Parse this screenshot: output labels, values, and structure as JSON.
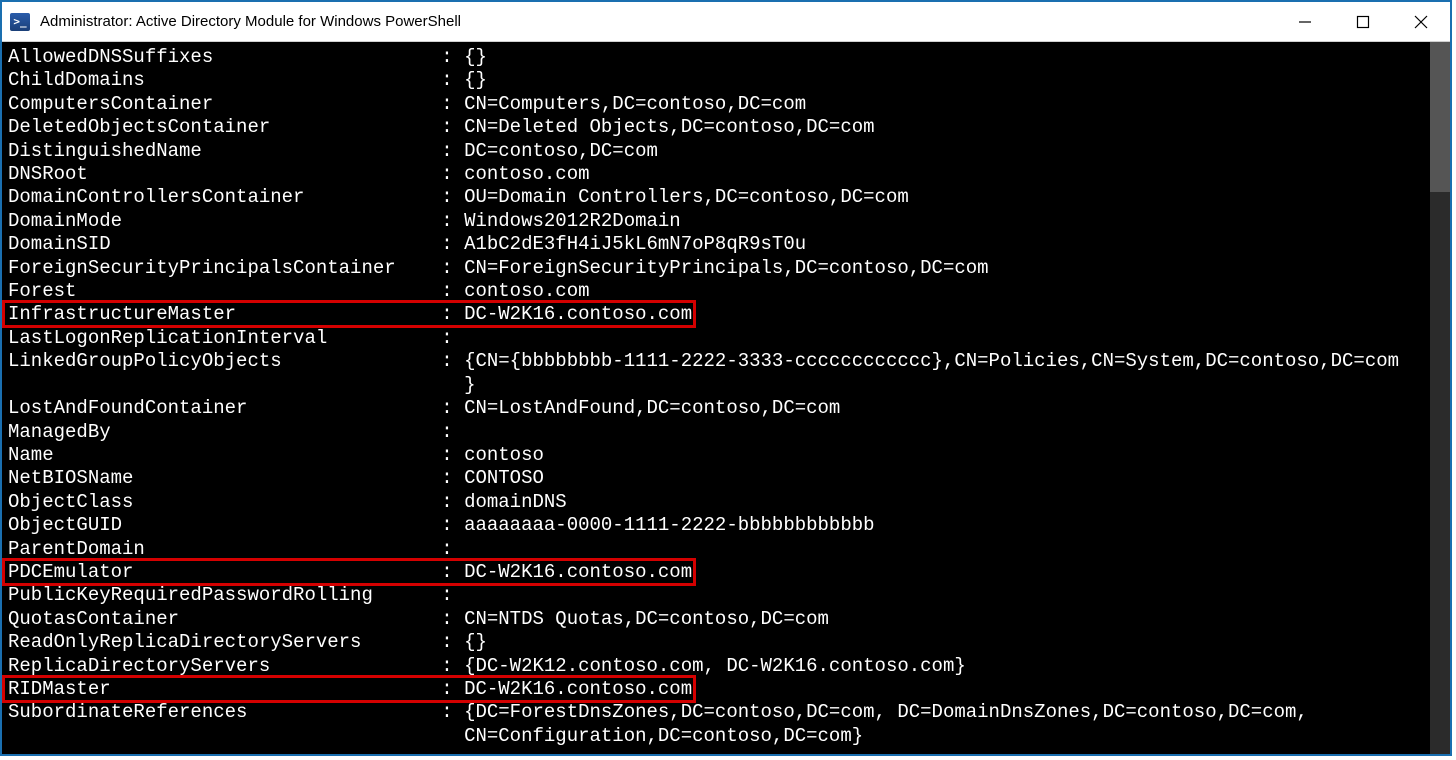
{
  "titlebar": {
    "icon_label": ">_",
    "title": "Administrator: Active Directory Module for Windows PowerShell"
  },
  "kv_width": 38,
  "lines": [
    {
      "key": "AllowedDNSSuffixes",
      "value": "{}",
      "highlight": false
    },
    {
      "key": "ChildDomains",
      "value": "{}",
      "highlight": false
    },
    {
      "key": "ComputersContainer",
      "value": "CN=Computers,DC=contoso,DC=com",
      "highlight": false
    },
    {
      "key": "DeletedObjectsContainer",
      "value": "CN=Deleted Objects,DC=contoso,DC=com",
      "highlight": false
    },
    {
      "key": "DistinguishedName",
      "value": "DC=contoso,DC=com",
      "highlight": false
    },
    {
      "key": "DNSRoot",
      "value": "contoso.com",
      "highlight": false
    },
    {
      "key": "DomainControllersContainer",
      "value": "OU=Domain Controllers,DC=contoso,DC=com",
      "highlight": false
    },
    {
      "key": "DomainMode",
      "value": "Windows2012R2Domain",
      "highlight": false
    },
    {
      "key": "DomainSID",
      "value": "A1bC2dE3fH4iJ5kL6mN7oP8qR9sT0u",
      "highlight": false
    },
    {
      "key": "ForeignSecurityPrincipalsContainer",
      "value": "CN=ForeignSecurityPrincipals,DC=contoso,DC=com",
      "highlight": false
    },
    {
      "key": "Forest",
      "value": "contoso.com",
      "highlight": false
    },
    {
      "key": "InfrastructureMaster",
      "value": "DC-W2K16.contoso.com",
      "highlight": true
    },
    {
      "key": "LastLogonReplicationInterval",
      "value": "",
      "highlight": false
    },
    {
      "key": "LinkedGroupPolicyObjects",
      "value": "{CN={bbbbbbbb-1111-2222-3333-cccccccccccc},CN=Policies,CN=System,DC=contoso,DC=com",
      "highlight": false
    },
    {
      "key": "",
      "value": "}",
      "highlight": false,
      "continuation": true
    },
    {
      "key": "LostAndFoundContainer",
      "value": "CN=LostAndFound,DC=contoso,DC=com",
      "highlight": false
    },
    {
      "key": "ManagedBy",
      "value": "",
      "highlight": false
    },
    {
      "key": "Name",
      "value": "contoso",
      "highlight": false
    },
    {
      "key": "NetBIOSName",
      "value": "CONTOSO",
      "highlight": false
    },
    {
      "key": "ObjectClass",
      "value": "domainDNS",
      "highlight": false
    },
    {
      "key": "ObjectGUID",
      "value": "aaaaaaaa-0000-1111-2222-bbbbbbbbbbbb",
      "highlight": false
    },
    {
      "key": "ParentDomain",
      "value": "",
      "highlight": false
    },
    {
      "key": "PDCEmulator",
      "value": "DC-W2K16.contoso.com",
      "highlight": true
    },
    {
      "key": "PublicKeyRequiredPasswordRolling",
      "value": "",
      "highlight": false
    },
    {
      "key": "QuotasContainer",
      "value": "CN=NTDS Quotas,DC=contoso,DC=com",
      "highlight": false
    },
    {
      "key": "ReadOnlyReplicaDirectoryServers",
      "value": "{}",
      "highlight": false
    },
    {
      "key": "ReplicaDirectoryServers",
      "value": "{DC-W2K12.contoso.com, DC-W2K16.contoso.com}",
      "highlight": false
    },
    {
      "key": "RIDMaster",
      "value": "DC-W2K16.contoso.com",
      "highlight": true
    },
    {
      "key": "SubordinateReferences",
      "value": "{DC=ForestDnsZones,DC=contoso,DC=com, DC=DomainDnsZones,DC=contoso,DC=com,",
      "highlight": false
    },
    {
      "key": "",
      "value": "CN=Configuration,DC=contoso,DC=com}",
      "highlight": false,
      "continuation": true
    }
  ]
}
